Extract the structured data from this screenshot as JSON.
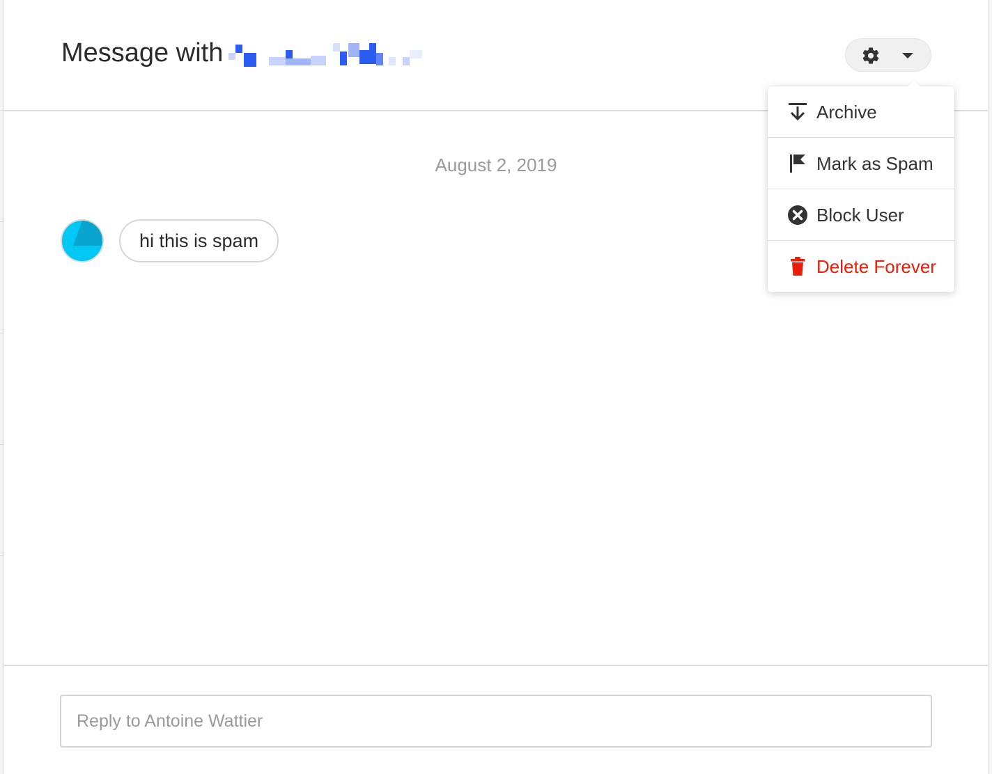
{
  "header": {
    "title": "Message with",
    "settings_menu": {
      "icon": "gear-icon",
      "caret_icon": "caret-down-icon"
    }
  },
  "dropdown": {
    "items": [
      {
        "label": "Archive",
        "icon": "archive-icon",
        "color": "#333333"
      },
      {
        "label": "Mark as Spam",
        "icon": "flag-icon",
        "color": "#333333"
      },
      {
        "label": "Block User",
        "icon": "block-icon",
        "color": "#333333"
      },
      {
        "label": "Delete Forever",
        "icon": "trash-icon",
        "color": "#e8200a"
      }
    ]
  },
  "conversation": {
    "date": "August 2, 2019",
    "messages": [
      {
        "text": "hi this is spam",
        "avatar_color": "#00c8f5"
      }
    ]
  },
  "composer": {
    "placeholder": "Reply to Antoine Wattier",
    "value": ""
  },
  "colors": {
    "accent_danger": "#e8200a",
    "avatar": "#00c8f5",
    "redaction_blue": "#2b5cf2"
  }
}
